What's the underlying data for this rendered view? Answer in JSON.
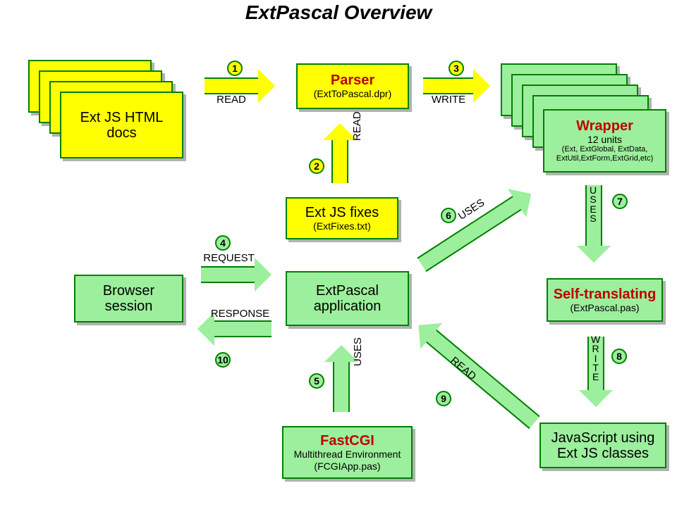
{
  "title": "ExtPascal Overview",
  "boxes": {
    "extjs_docs": {
      "head_plain": "Ext JS HTML docs"
    },
    "parser": {
      "head": "Parser",
      "sub": "(ExtToPascal.dpr)"
    },
    "wrapper": {
      "head": "Wrapper",
      "sub1": "12 units",
      "sub2": "(Ext, ExtGlobal, ExtData, ExtUtil,ExtForm,ExtGrid,etc)"
    },
    "fixes": {
      "head_plain": "Ext JS fixes",
      "sub": "(ExtFixes.txt)"
    },
    "browser": {
      "head_plain": "Browser session"
    },
    "extpascal_app": {
      "head_plain": "ExtPascal application"
    },
    "self_translating": {
      "head": "Self-translating",
      "sub": "(ExtPascal.pas)"
    },
    "fastcgi": {
      "head": "FastCGI",
      "sub1": "Multithread Environment",
      "sub2": "(FCGIApp.pas)"
    },
    "js_using": {
      "head_plain": "JavaScript using Ext JS classes"
    }
  },
  "arrows": {
    "a1": "READ",
    "a2": "READ",
    "a3": "WRITE",
    "a4": "REQUEST",
    "a5": "USES",
    "a6": "USES",
    "a7": "USES",
    "a8": "WRITE",
    "a9": "READ",
    "a10": "RESPONSE"
  },
  "badges": {
    "b1": "1",
    "b2": "2",
    "b3": "3",
    "b4": "4",
    "b5": "5",
    "b6": "6",
    "b7": "7",
    "b8": "8",
    "b9": "9",
    "b10": "10"
  }
}
